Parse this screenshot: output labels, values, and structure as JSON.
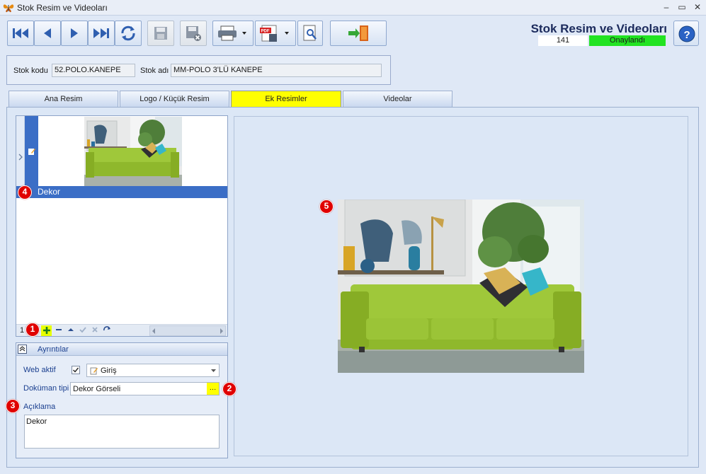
{
  "window": {
    "title": "Stok Resim ve Videoları",
    "minimize": "–",
    "restore": "▭",
    "close": "✕"
  },
  "header": {
    "title": "Stok Resim ve Videoları",
    "record_no": "141",
    "status": "Onaylandı",
    "status_color": "#22e322"
  },
  "toolbar": {
    "buttons": [
      "first-icon",
      "prev-icon",
      "next-icon",
      "last-icon",
      "refresh-icon",
      "save-icon",
      "delete-icon",
      "print-icon",
      "pdf-icon",
      "preview-icon",
      "exit-icon"
    ]
  },
  "stok": {
    "kod_label": "Stok kodu",
    "kod_value": "52.POLO.KANEPE",
    "adi_label": "Stok adı",
    "adi_value": "MM-POLO 3'LÜ KANEPE"
  },
  "tabs": [
    {
      "label": "Ana Resim"
    },
    {
      "label": "Logo / Küçük Resim"
    },
    {
      "label": "Ek Resimler",
      "active": true
    },
    {
      "label": "Videolar"
    }
  ],
  "gallery": {
    "items": [
      {
        "caption": "Dekor"
      }
    ],
    "nav": {
      "record": "1",
      "buttons": [
        "add-icon",
        "delete-icon",
        "up-icon",
        "check-icon",
        "cancel-icon",
        "refresh-icon"
      ]
    }
  },
  "details": {
    "title": "Ayrıntılar",
    "web_aktif_label": "Web aktif",
    "web_aktif_checked": true,
    "giris_value": "Giriş",
    "dokuman_label": "Doküman tipi",
    "dokuman_value": "Dekor Görseli",
    "ellipsis": "…",
    "aciklama_label": "Açıklama",
    "aciklama_value": "Dekor"
  },
  "badges": {
    "b1": "1",
    "b2": "2",
    "b3": "3",
    "b4": "4",
    "b5": "5"
  },
  "colors": {
    "accent_blue": "#3b6ec6",
    "tab_active": "#ffff00",
    "badge_red": "#e00000"
  }
}
